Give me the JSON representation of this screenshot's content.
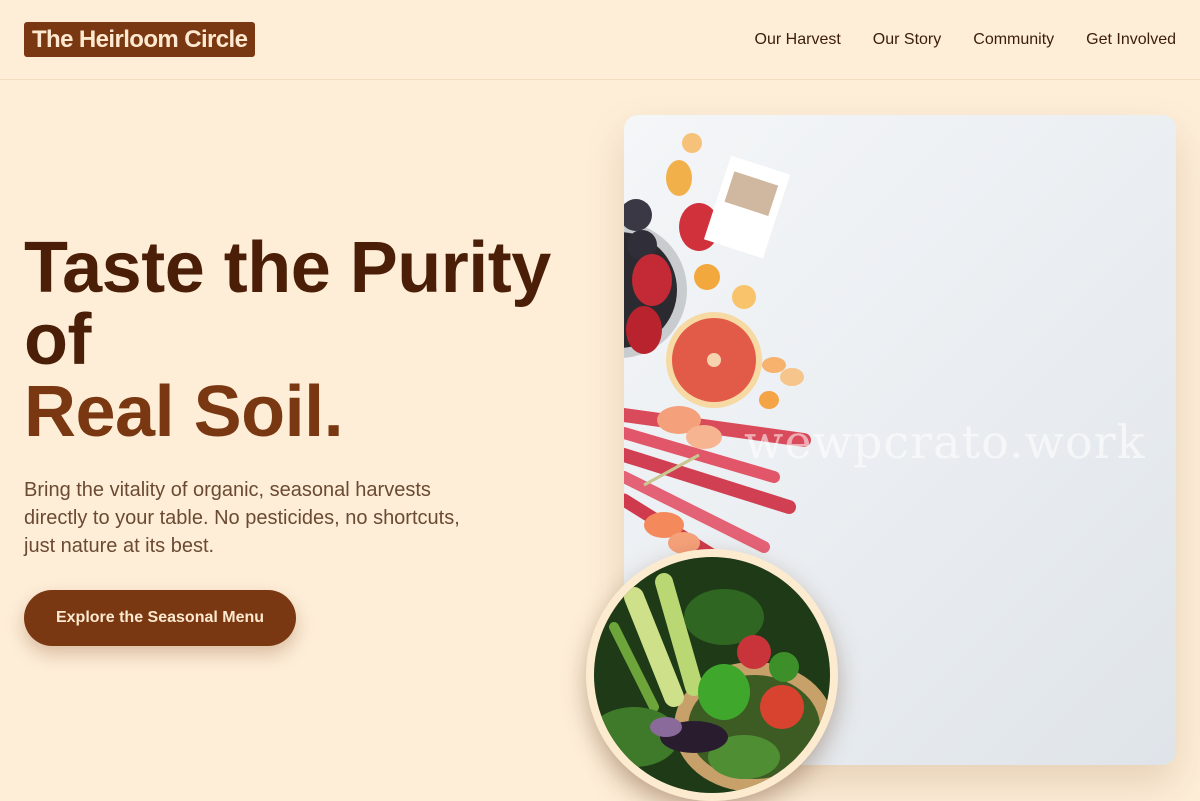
{
  "header": {
    "logo": "The Heirloom Circle",
    "nav": [
      "Our Harvest",
      "Our Story",
      "Community",
      "Get Involved"
    ]
  },
  "hero": {
    "title_line1": "Taste the Purity",
    "title_line2": "of",
    "title_line3": "Real Soil.",
    "subtitle": "Bring the vitality of organic, seasonal harvests directly to your table. No pesticides, no shortcuts, just nature at its best.",
    "cta": "Explore the Seasonal Menu"
  },
  "images": {
    "watermark": "wewpcrato.work",
    "small_watermark": "crato.work"
  },
  "colors": {
    "background": "#feeed8",
    "brand": "#7a3812",
    "heading": "#4a1e07",
    "body_text": "#6b4a33"
  }
}
